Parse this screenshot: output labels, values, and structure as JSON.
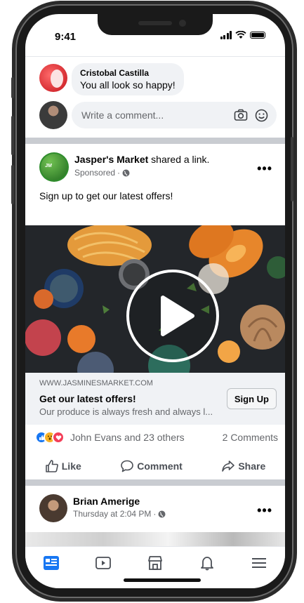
{
  "status": {
    "time": "9:41"
  },
  "comment": {
    "author": "Cristobal Castilla",
    "text": "You all look so happy!"
  },
  "comment_input": {
    "placeholder": "Write a comment..."
  },
  "ad_post": {
    "page_name": "Jasper's Market",
    "action_text": "shared a link.",
    "meta": "Sponsored",
    "caption": "Sign up to get our latest offers!",
    "link": {
      "domain": "WWW.JASMINESMARKET.COM",
      "title": "Get our latest offers!",
      "description": "Our produce is always fresh and always l...",
      "cta": "Sign Up"
    },
    "reactions_text": "John Evans and 23 others",
    "comments_count": "2 Comments",
    "actions": {
      "like": "Like",
      "comment": "Comment",
      "share": "Share"
    }
  },
  "next_post": {
    "author": "Brian Amerige",
    "meta": "Thursday at 2:04 PM"
  },
  "tab_bar": {
    "tabs": [
      "news-feed",
      "watch",
      "marketplace",
      "notifications",
      "menu"
    ],
    "active": "news-feed"
  },
  "colors": {
    "accent": "#1877f2",
    "bubble_bg": "#f0f2f5",
    "secondary_text": "#65676b",
    "like_blue": "#1877f2",
    "love_red": "#f33e58",
    "wow_yellow": "#f7b125"
  }
}
